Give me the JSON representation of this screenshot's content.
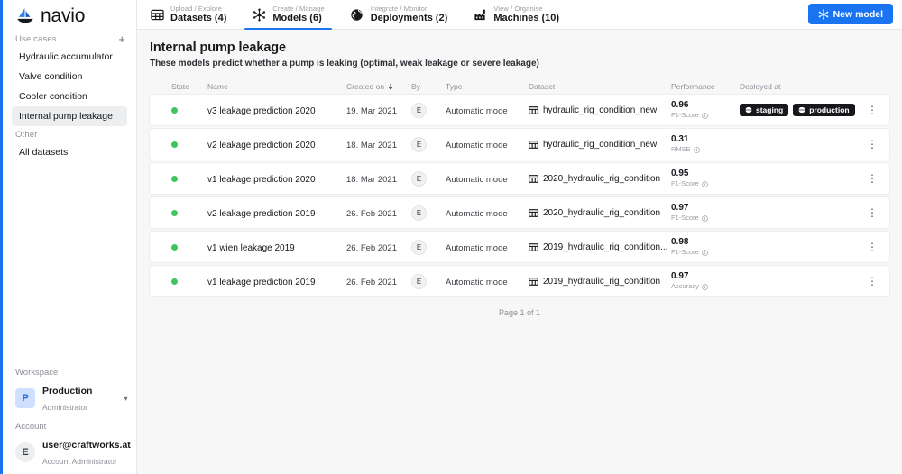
{
  "brand": {
    "name": "navio",
    "logo_icon": "sailboat-icon",
    "accent_color": "#1a73f0"
  },
  "sidebar": {
    "use_cases_label": "Use cases",
    "add_icon": "plus-icon",
    "use_cases": [
      {
        "label": "Hydraulic accumulator",
        "active": false
      },
      {
        "label": "Valve condition",
        "active": false
      },
      {
        "label": "Cooler condition",
        "active": false
      },
      {
        "label": "Internal pump leakage",
        "active": true
      }
    ],
    "other_label": "Other",
    "other_items": [
      {
        "label": "All datasets",
        "active": false
      }
    ],
    "workspace": {
      "section_label": "Workspace",
      "avatar_initial": "P",
      "name": "Production",
      "role": "Administrator",
      "switch_icon": "chevron-updown-icon"
    },
    "account": {
      "section_label": "Account",
      "avatar_initial": "E",
      "name": "user@craftworks.at",
      "role": "Account Administrator"
    }
  },
  "topbar": {
    "tabs": [
      {
        "eyebrow": "Upload / Explore",
        "label": "Datasets (4)",
        "icon": "table-grid-icon",
        "active": false
      },
      {
        "eyebrow": "Create / Manage",
        "label": "Models (6)",
        "icon": "model-nodes-icon",
        "active": true
      },
      {
        "eyebrow": "Integrate / Monitor",
        "label": "Deployments (2)",
        "icon": "globe-icon",
        "active": false
      },
      {
        "eyebrow": "View / Organise",
        "label": "Machines (10)",
        "icon": "factory-icon",
        "active": false
      }
    ],
    "new_model_button": {
      "label": "New model",
      "icon": "model-nodes-icon"
    }
  },
  "page": {
    "title": "Internal pump leakage",
    "subtitle": "These models predict whether a pump is leaking (optimal, weak leakage or severe leakage)"
  },
  "table": {
    "columns": [
      {
        "key": "state",
        "label": "State"
      },
      {
        "key": "name",
        "label": "Name"
      },
      {
        "key": "created_on",
        "label": "Created on",
        "sort_icon": "arrow-down-icon",
        "sorted": true
      },
      {
        "key": "by",
        "label": "By"
      },
      {
        "key": "type",
        "label": "Type"
      },
      {
        "key": "dataset",
        "label": "Dataset"
      },
      {
        "key": "performance",
        "label": "Performance"
      },
      {
        "key": "deployed_at",
        "label": "Deployed at"
      }
    ],
    "rows": [
      {
        "state": "active",
        "name": "v3 leakage prediction 2020",
        "created_on": "19. Mar 2021",
        "by": "E",
        "type": "Automatic mode",
        "dataset": "hydraulic_rig_condition_new",
        "perf_value": "0.96",
        "perf_label": "F1-Score",
        "deployed_at": [
          {
            "label": "staging"
          },
          {
            "label": "production"
          }
        ]
      },
      {
        "state": "active",
        "name": "v2 leakage prediction 2020",
        "created_on": "18. Mar 2021",
        "by": "E",
        "type": "Automatic mode",
        "dataset": "hydraulic_rig_condition_new",
        "perf_value": "0.31",
        "perf_label": "RMSE",
        "deployed_at": []
      },
      {
        "state": "active",
        "name": "v1 leakage prediction 2020",
        "created_on": "18. Mar 2021",
        "by": "E",
        "type": "Automatic mode",
        "dataset": "2020_hydraulic_rig_condition",
        "perf_value": "0.95",
        "perf_label": "F1-Score",
        "deployed_at": []
      },
      {
        "state": "active",
        "name": "v2 leakage prediction 2019",
        "created_on": "26. Feb 2021",
        "by": "E",
        "type": "Automatic mode",
        "dataset": "2020_hydraulic_rig_condition",
        "perf_value": "0.97",
        "perf_label": "F1-Score",
        "deployed_at": []
      },
      {
        "state": "active",
        "name": "v1 wien leakage 2019",
        "created_on": "26. Feb 2021",
        "by": "E",
        "type": "Automatic mode",
        "dataset": "2019_hydraulic_rig_condition...",
        "perf_value": "0.98",
        "perf_label": "F1-Score",
        "deployed_at": []
      },
      {
        "state": "active",
        "name": "v1 leakage prediction 2019",
        "created_on": "26. Feb 2021",
        "by": "E",
        "type": "Automatic mode",
        "dataset": "2019_hydraulic_rig_condition",
        "perf_value": "0.97",
        "perf_label": "Accuracy",
        "deployed_at": []
      }
    ],
    "pagination": "Page 1 of 1",
    "state_dot_color": "#3fc55f",
    "badge_color": "#17181c"
  }
}
